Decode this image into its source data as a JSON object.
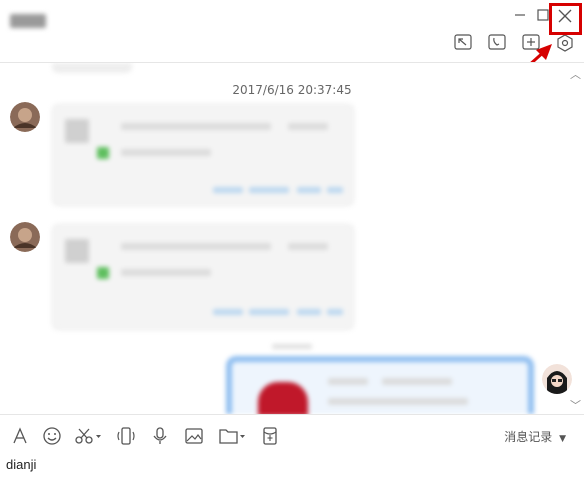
{
  "window": {
    "title": ""
  },
  "title_bar": {
    "minimize_icon": "minimize-icon",
    "maximize_icon": "maximize-icon",
    "close_icon": "close-icon",
    "actions": [
      "screen-share-icon",
      "call-icon",
      "add-icon",
      "settings-icon"
    ]
  },
  "chat": {
    "timestamp": "2017/6/16 20:37:45"
  },
  "toolbar": {
    "items": [
      "font-icon",
      "emoji-icon",
      "screenshot-icon",
      "shake-icon",
      "voice-icon",
      "image-icon",
      "file-icon",
      "red-packet-icon"
    ],
    "message_history_label": "消息记录"
  },
  "input": {
    "value": "dianji"
  },
  "colors": {
    "annotation_red": "#d60000",
    "accent_blue": "#8fbef0"
  }
}
